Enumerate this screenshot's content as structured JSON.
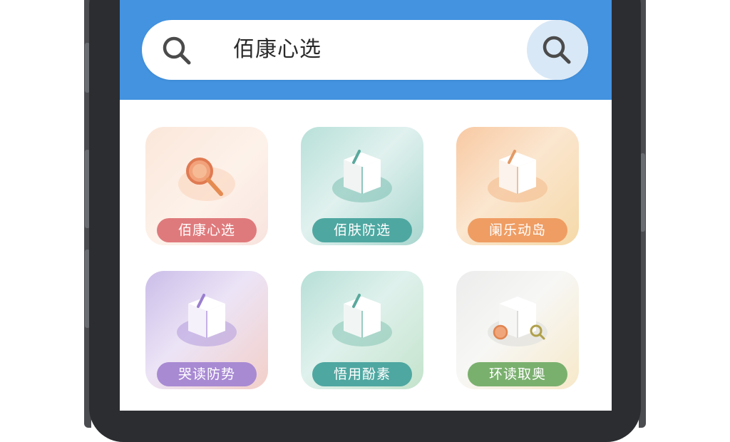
{
  "search": {
    "query": "佰康心选"
  },
  "tiles": [
    {
      "label": "佰康心选",
      "icon": "magnifier-icon",
      "label_color": "#df7a7c"
    },
    {
      "label": "佰肤防选",
      "icon": "box-icon",
      "label_color": "#4fa7a1"
    },
    {
      "label": "阑乐动岛",
      "icon": "box-icon",
      "label_color": "#ef9d63"
    },
    {
      "label": "哭读防势",
      "icon": "box-icon",
      "label_color": "#a88ad3"
    },
    {
      "label": "悟用酚素",
      "icon": "box-icon",
      "label_color": "#4fa7a1"
    },
    {
      "label": "环读取奥",
      "icon": "box-icon",
      "label_color": "#7ab06e"
    }
  ],
  "colors": {
    "header": "#4393e0",
    "search_button_bg": "#d9e8f6"
  }
}
